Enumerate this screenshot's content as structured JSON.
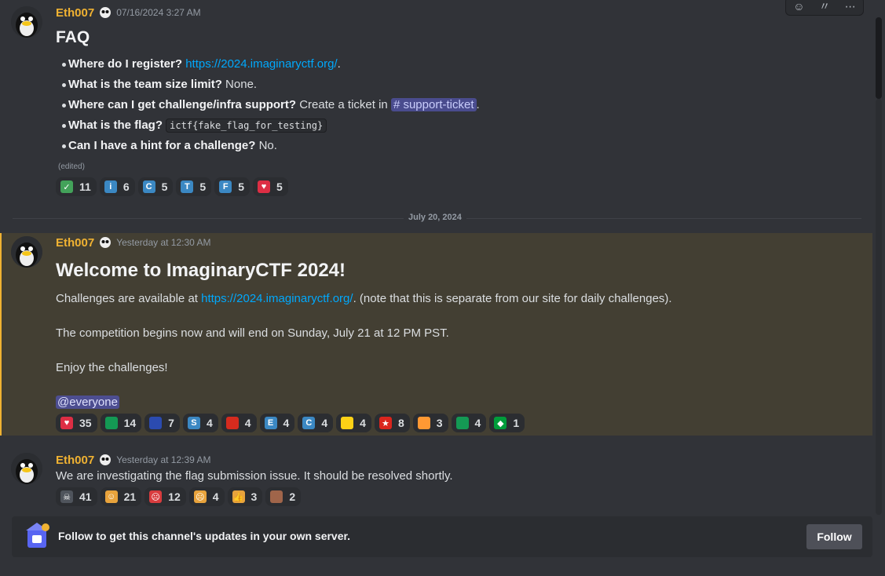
{
  "message1": {
    "username": "Eth007",
    "timestamp": "07/16/2024 3:27 AM",
    "heading": "FAQ",
    "faq": [
      {
        "q": "Where do I register?",
        "a_link": "https://2024.imaginaryctf.org/",
        "a_after": "."
      },
      {
        "q": "What is the team size limit?",
        "a": "None."
      },
      {
        "q": "Where can I get challenge/infra support?",
        "a": "Create a ticket in",
        "channel": "support-ticket",
        "a_after": "."
      },
      {
        "q": "What is the flag?",
        "code": "ictf{fake_flag_for_testing}"
      },
      {
        "q": "Can I have a hint for a challenge?",
        "a": "No."
      }
    ],
    "edited": "(edited)",
    "reactions": [
      {
        "emoji": "check-mark",
        "label": "✓",
        "color": "#43a25a",
        "count": "11"
      },
      {
        "emoji": "letter-i",
        "label": "i",
        "color": "#3b88c3",
        "count": "6"
      },
      {
        "emoji": "letter-c",
        "label": "C",
        "color": "#3b88c3",
        "count": "5"
      },
      {
        "emoji": "letter-t",
        "label": "T",
        "color": "#3b88c3",
        "count": "5"
      },
      {
        "emoji": "letter-f",
        "label": "F",
        "color": "#3b88c3",
        "count": "5"
      },
      {
        "emoji": "heart",
        "label": "♥",
        "color": "#dd2e44",
        "count": "5"
      }
    ]
  },
  "date_divider": "July 20, 2024",
  "message2": {
    "username": "Eth007",
    "timestamp": "Yesterday at 12:30 AM",
    "heading": "Welcome to ImaginaryCTF 2024!",
    "line1_before": "Challenges are available at",
    "line1_link": "https://2024.imaginaryctf.org/",
    "line1_after": ". (note that this is separate from our site for daily challenges).",
    "line2": "The competition begins now and will end on Sunday, July 21 at 12 PM PST.",
    "line3": "Enjoy the challenges!",
    "mention": "@everyone",
    "reactions": [
      {
        "emoji": "heart",
        "label": "♥",
        "color": "#dd2e44",
        "count": "35"
      },
      {
        "emoji": "flag-palestine",
        "label": "",
        "color": "#149954",
        "count": "14"
      },
      {
        "emoji": "flag-france",
        "label": "",
        "color": "#2b4bb0",
        "count": "7"
      },
      {
        "emoji": "letter-s",
        "label": "S",
        "color": "#3b88c3",
        "count": "4"
      },
      {
        "emoji": "flag-portugal",
        "label": "",
        "color": "#d52b1e",
        "count": "4"
      },
      {
        "emoji": "letter-e",
        "label": "E",
        "color": "#3b88c3",
        "count": "4"
      },
      {
        "emoji": "letter-c",
        "label": "C",
        "color": "#3b88c3",
        "count": "4"
      },
      {
        "emoji": "flag-romania",
        "label": "",
        "color": "#fcd116",
        "count": "4"
      },
      {
        "emoji": "flag-vietnam",
        "label": "★",
        "color": "#da251d",
        "count": "8"
      },
      {
        "emoji": "flag-india",
        "label": "",
        "color": "#ff9933",
        "count": "3"
      },
      {
        "emoji": "flag-palestine",
        "label": "",
        "color": "#149954",
        "count": "4"
      },
      {
        "emoji": "flag-brazil",
        "label": "◆",
        "color": "#009c3b",
        "count": "1"
      }
    ]
  },
  "message3": {
    "username": "Eth007",
    "timestamp": "Yesterday at 12:39 AM",
    "text": "We are investigating the flag submission issue. It should be resolved shortly.",
    "reactions": [
      {
        "emoji": "skull",
        "label": "☠",
        "color": "#4f545c",
        "count": "41"
      },
      {
        "emoji": "saluting-face",
        "label": "☺",
        "color": "#e8a33c",
        "count": "21"
      },
      {
        "emoji": "angry-face",
        "label": "☹",
        "color": "#d83c3e",
        "count": "12"
      },
      {
        "emoji": "crying-face",
        "label": "☹",
        "color": "#e8a33c",
        "count": "4"
      },
      {
        "emoji": "thumbs-up",
        "label": "👍",
        "color": "#e8a33c",
        "count": "3"
      },
      {
        "emoji": "custom-emoji",
        "label": "",
        "color": "#a0654a",
        "count": "2"
      }
    ]
  },
  "follow": {
    "text": "Follow to get this channel's updates in your own server.",
    "button": "Follow"
  }
}
